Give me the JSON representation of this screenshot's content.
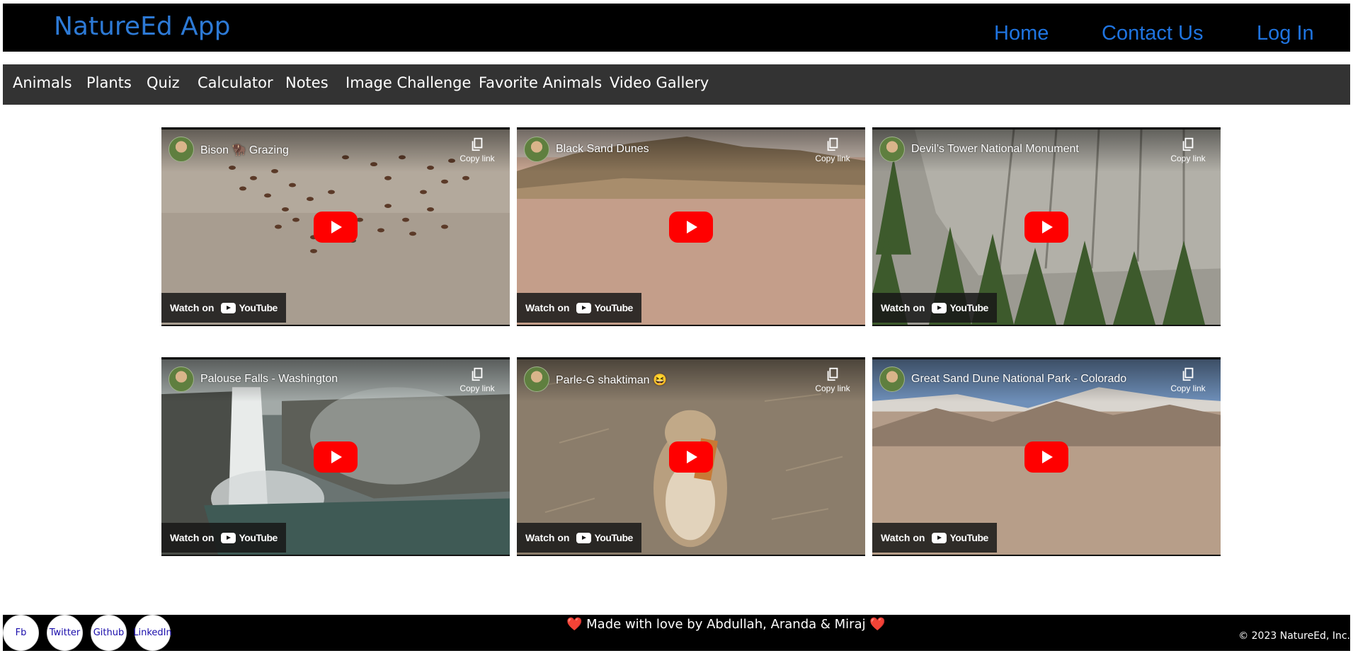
{
  "header": {
    "brand": "NatureEd App",
    "nav": [
      "Home",
      "Contact Us",
      "Log In"
    ]
  },
  "menu": {
    "items": [
      "Animals",
      "Plants",
      "Quiz",
      "Calculator",
      "Notes",
      "Image Challenge",
      "Favorite Animals",
      "Video Gallery"
    ]
  },
  "videos": [
    {
      "title": "Bison 🦬 Grazing",
      "copy_label": "Copy link",
      "watch_label": "Watch on",
      "platform": "YouTube"
    },
    {
      "title": "Black Sand Dunes",
      "copy_label": "Copy link",
      "watch_label": "Watch on",
      "platform": "YouTube"
    },
    {
      "title": "Devil’s Tower National Monument",
      "copy_label": "Copy link",
      "watch_label": "Watch on",
      "platform": "YouTube"
    },
    {
      "title": "Palouse Falls - Washington",
      "copy_label": "Copy link",
      "watch_label": "Watch on",
      "platform": "YouTube"
    },
    {
      "title": "Parle-G shaktiman 😆",
      "copy_label": "Copy link",
      "watch_label": "Watch on",
      "platform": "YouTube"
    },
    {
      "title": "Great Sand Dune National Park - Colorado",
      "copy_label": "Copy link",
      "watch_label": "Watch on",
      "platform": "YouTube"
    }
  ],
  "footer": {
    "made_by": "Made with love by Abdullah, Aranda & Miraj",
    "heart": "❤️",
    "copyright": "© 2023 NatureEd, Inc.",
    "social": [
      "Fb",
      "Twitter",
      "Github",
      "LinkedIn"
    ]
  },
  "colors": {
    "brand": "#2d7ad6",
    "nav_link": "#1f74e0",
    "menubar": "#333333",
    "play_button": "#ff0000"
  }
}
